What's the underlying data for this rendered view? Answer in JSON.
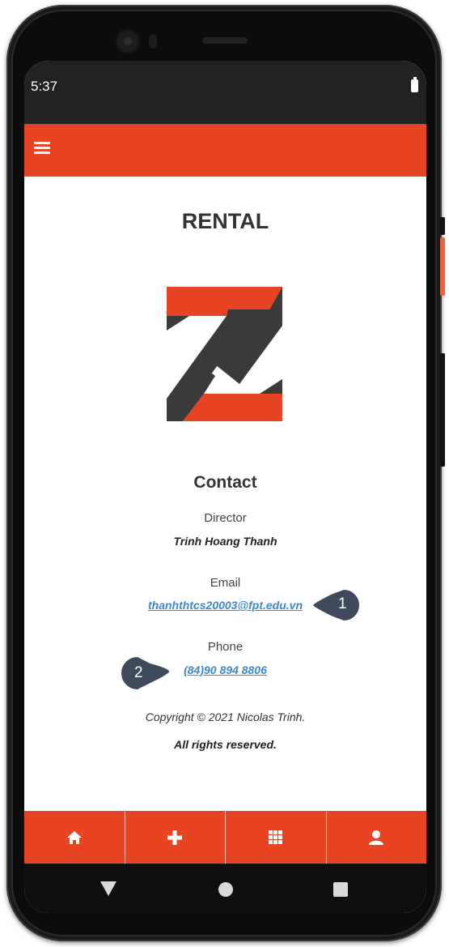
{
  "status_bar": {
    "time": "5:37"
  },
  "header": {
    "menu_icon": "hamburger-menu-icon",
    "color": "#e84322"
  },
  "main": {
    "title": "RENTAL",
    "logo": "Z-logo",
    "contact": {
      "heading": "Contact",
      "director_label": "Director",
      "director_name": "Trinh Hoang Thanh",
      "email_label": "Email",
      "email": "thanhthtcs20003@fpt.edu.vn",
      "phone_label": "Phone",
      "phone": "(84)90 894 8806"
    },
    "copyright": "Copyright © 2021 Nicolas Trinh.",
    "rights": "All rights reserved."
  },
  "tab_bar": {
    "items": [
      {
        "icon": "home-icon"
      },
      {
        "icon": "plus-icon"
      },
      {
        "icon": "grid-icon"
      },
      {
        "icon": "user-icon"
      }
    ]
  },
  "nav_bar": {
    "buttons": [
      "back-icon",
      "home-circle-icon",
      "recents-square-icon"
    ]
  },
  "callouts": [
    {
      "number": "1"
    },
    {
      "number": "2"
    }
  ],
  "colors": {
    "accent": "#e84322",
    "link": "#3a8ad0",
    "logo_dark": "#3a3a3a"
  }
}
